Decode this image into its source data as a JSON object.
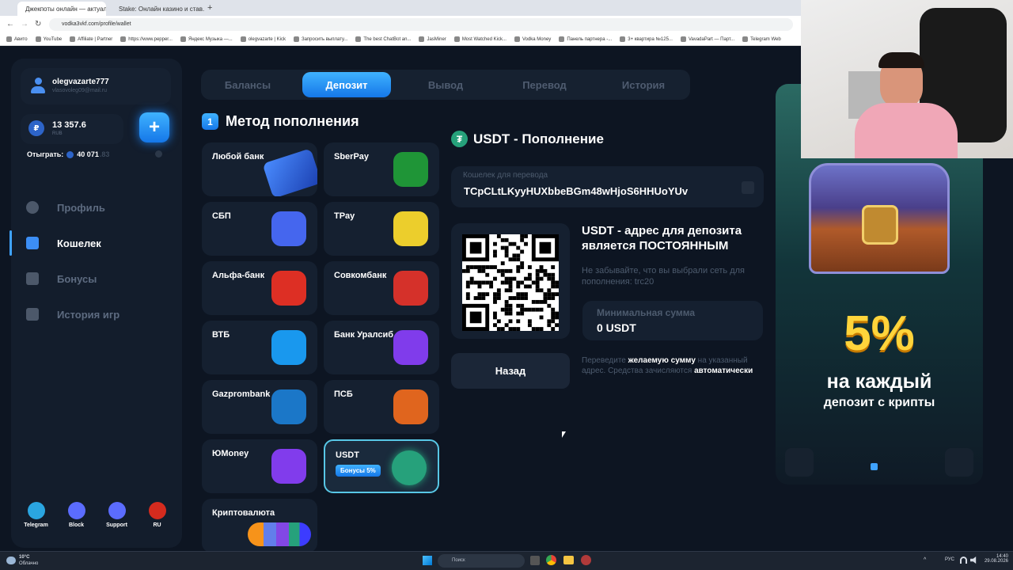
{
  "browser": {
    "tabs": [
      {
        "label": "Джекпоты онлайн — актуаль..."
      },
      {
        "label": "Stake: Онлайн казино и став..."
      }
    ],
    "url": "vodka3vkf.com/profile/wallet",
    "bookmarks": [
      "Авито",
      "YouTube",
      "Affiliate | Partner",
      "https://www.pepper...",
      "Яндекс Музыка —...",
      "olegvazarte | Kick",
      "Запросить выплату...",
      "The best ChatBot an...",
      "JasMiner",
      "Most Watched Kick...",
      "Vodka Money",
      "Панель партнера -...",
      "3+ квартира №125...",
      "VavadaPart — Парт...",
      "Telegram Web"
    ]
  },
  "sidebar": {
    "username": "olegvazarte777",
    "email": "vlasovoleg09@mail.ru",
    "balance": "13 357.6",
    "currency": "RUB",
    "wager_label": "Отыграть:",
    "wager_value": "40 071",
    "wager_decimal": ".83",
    "add_symbol": "+",
    "nav": [
      {
        "label": "Профиль",
        "icon": "user-icon"
      },
      {
        "label": "Кошелек",
        "icon": "wallet-icon"
      },
      {
        "label": "Бонусы",
        "icon": "gift-icon"
      },
      {
        "label": "История игр",
        "icon": "history-icon"
      }
    ],
    "socials": [
      {
        "label": "Telegram",
        "icon": "telegram-icon",
        "color": "#2aa5e0"
      },
      {
        "label": "Block",
        "icon": "lock-icon",
        "color": "#5b6cff"
      },
      {
        "label": "Support",
        "icon": "support-icon",
        "color": "#5b6cff"
      },
      {
        "label": "RU",
        "icon": "flag-ru-icon",
        "color": "#d52b1e"
      }
    ]
  },
  "tabs": [
    "Балансы",
    "Депозит",
    "Вывод",
    "Перевод",
    "История"
  ],
  "methods": {
    "step": "1",
    "title": "Метод пополнения",
    "items": [
      {
        "label": "Любой банк",
        "icon": "bank-card-icon",
        "color": "#3a7bff"
      },
      {
        "label": "SberPay",
        "icon": "sber-icon",
        "color": "#21a038"
      },
      {
        "label": "СБП",
        "icon": "sbp-terminal-icon",
        "color": "#4a6cff"
      },
      {
        "label": "TPay",
        "icon": "tbank-icon",
        "color": "#ffdd2d"
      },
      {
        "label": "Альфа-банк",
        "icon": "alfa-icon",
        "color": "#ef3124"
      },
      {
        "label": "Совкомбанк",
        "icon": "sovcom-icon",
        "color": "#e6332a"
      },
      {
        "label": "ВТБ",
        "icon": "vtb-icon",
        "color": "#1aa3ff"
      },
      {
        "label": "Банк Уралсиб",
        "icon": "uralsib-icon",
        "color": "#8a3ffc"
      },
      {
        "label": "Gazprombank",
        "icon": "gazprom-icon",
        "color": "#1c7fd6"
      },
      {
        "label": "ПСБ",
        "icon": "psb-icon",
        "color": "#f26b1d"
      },
      {
        "label": "ЮMoney",
        "icon": "yoomoney-icon",
        "color": "#8b3ffd"
      },
      {
        "label": "USDT",
        "icon": "tether-icon",
        "color": "#26a17b",
        "badge": "Бонусы 5%"
      },
      {
        "label": "Криптовалюта",
        "icon": "crypto-coins-icon",
        "color": "#f7931a"
      }
    ]
  },
  "deposit": {
    "title": "USDT - Пополнение",
    "wallet_label": "Кошелек для перевода",
    "wallet_address": "TCpCLtLKyyHUXbbeBGm48wHjoS6HHUoYUv",
    "address_heading": "USDT - адрес для депозита является ПОСТОЯННЫМ",
    "network_note": "Не забывайте, что вы выбрали сеть для пополнения: trc20",
    "min_label": "Минимальная сумма",
    "min_value": "0 USDT",
    "back_label": "Назад",
    "instruction_pre": "Переведите ",
    "instruction_bold": "желаемую сумму",
    "instruction_mid": " на указанный адрес. Средства зачисляются ",
    "instruction_bold2": "автоматически"
  },
  "banner": {
    "percent": "5%",
    "line1": "на каждый",
    "line2": "депозит с крипты"
  },
  "taskbar": {
    "weather_temp": "10°C",
    "weather_desc": "Облачно",
    "search_placeholder": "Поиск",
    "lang": "РУС",
    "time": "14:40",
    "date": "29.08.2026"
  }
}
